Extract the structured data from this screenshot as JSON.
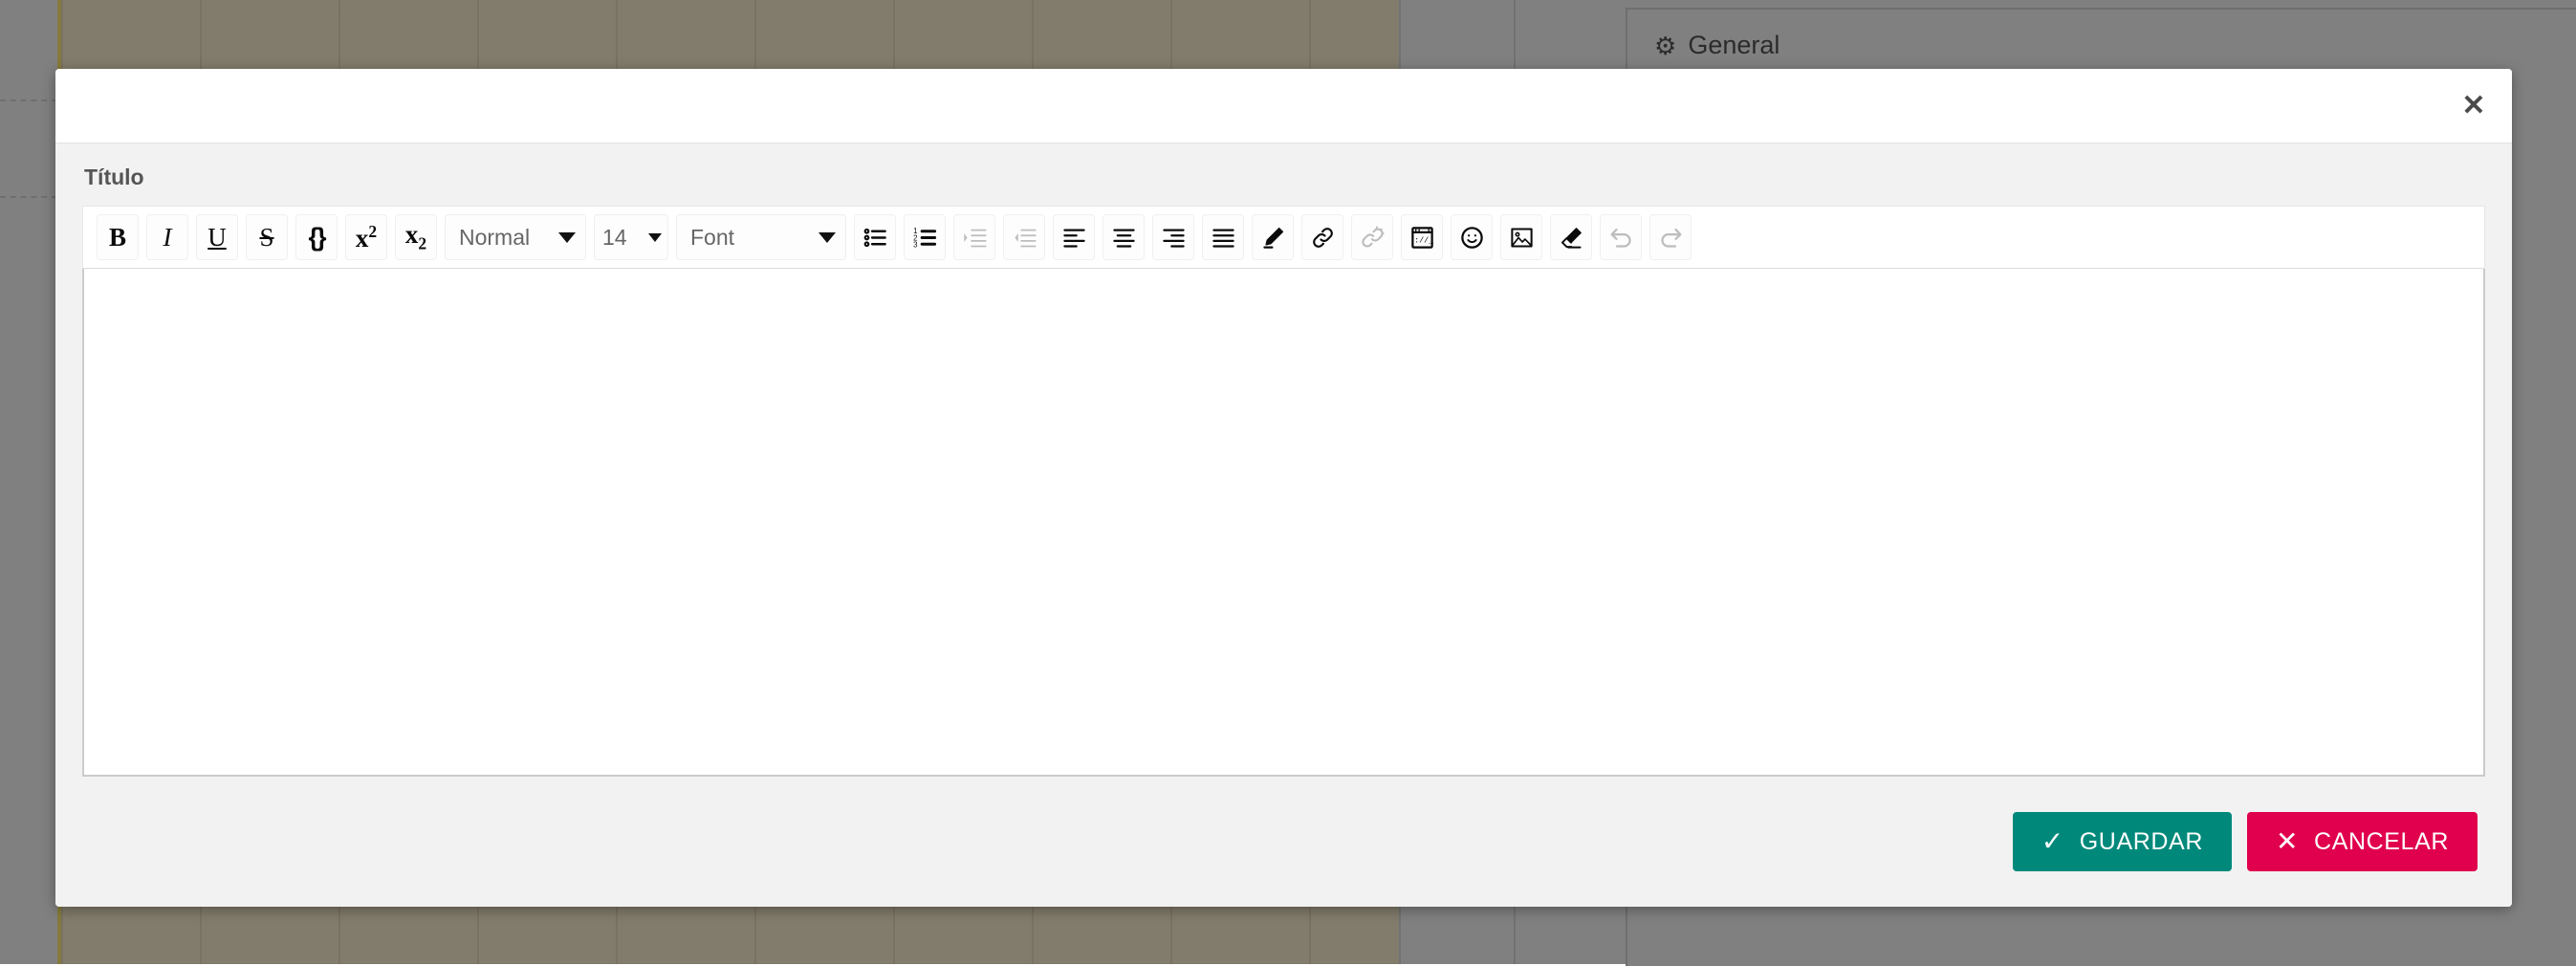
{
  "background": {
    "right_panel": {
      "gear_icon": "gear-icon",
      "title": "General"
    }
  },
  "modal": {
    "close_label": "✕",
    "field_label": "Título",
    "editor": {
      "content": "",
      "placeholder": ""
    },
    "toolbar": {
      "buttons": [
        {
          "name": "bold",
          "glyph": "B",
          "kind": "b",
          "disabled": false,
          "title": "Bold"
        },
        {
          "name": "italic",
          "glyph": "I",
          "kind": "i",
          "disabled": false,
          "title": "Italic"
        },
        {
          "name": "underline",
          "glyph": "U",
          "kind": "u",
          "disabled": false,
          "title": "Underline"
        },
        {
          "name": "strikethrough",
          "glyph": "S",
          "kind": "s",
          "disabled": false,
          "title": "Strikethrough"
        },
        {
          "name": "code-block",
          "glyph": "{}",
          "kind": "code",
          "disabled": false,
          "title": "Code"
        },
        {
          "name": "superscript",
          "glyph": "x",
          "kind": "sup",
          "sup": "2",
          "disabled": false,
          "title": "Superscript"
        },
        {
          "name": "subscript",
          "glyph": "x",
          "kind": "sub",
          "sub": "2",
          "disabled": false,
          "title": "Subscript"
        }
      ],
      "selects": [
        {
          "name": "format-select",
          "value": "Normal",
          "width": "w-format"
        },
        {
          "name": "font-size-select",
          "value": "14",
          "width": "w-size"
        },
        {
          "name": "font-family-select",
          "value": "Font",
          "width": "w-font"
        }
      ],
      "icon_buttons": [
        {
          "name": "bullet-list-icon",
          "icon": "bullet-list",
          "disabled": false
        },
        {
          "name": "numbered-list-icon",
          "icon": "numbered-list",
          "disabled": false
        },
        {
          "name": "indent-increase-icon",
          "icon": "indent-increase",
          "disabled": true
        },
        {
          "name": "indent-decrease-icon",
          "icon": "indent-decrease",
          "disabled": true
        },
        {
          "name": "align-left-icon",
          "icon": "align-left",
          "disabled": false
        },
        {
          "name": "align-center-icon",
          "icon": "align-center",
          "disabled": false
        },
        {
          "name": "align-right-icon",
          "icon": "align-right",
          "disabled": false
        },
        {
          "name": "align-justify-icon",
          "icon": "align-justify",
          "disabled": false
        },
        {
          "name": "highlighter-pen-icon",
          "icon": "pen",
          "disabled": false
        },
        {
          "name": "link-icon",
          "icon": "link",
          "disabled": false
        },
        {
          "name": "unlink-icon",
          "icon": "unlink",
          "disabled": true
        },
        {
          "name": "embed-url-icon",
          "icon": "embed",
          "disabled": false
        },
        {
          "name": "emoji-icon",
          "icon": "emoji",
          "disabled": false
        },
        {
          "name": "image-icon",
          "icon": "image",
          "disabled": false
        },
        {
          "name": "clear-format-eraser-icon",
          "icon": "eraser",
          "disabled": false
        },
        {
          "name": "undo-icon",
          "icon": "undo",
          "disabled": true
        },
        {
          "name": "redo-icon",
          "icon": "redo",
          "disabled": true
        }
      ]
    },
    "footer": {
      "save_label": "GUARDAR",
      "save_icon": "check-icon",
      "cancel_label": "CANCELAR",
      "cancel_icon": "close-x-icon"
    }
  },
  "colors": {
    "save_green": "#00897b",
    "cancel_red": "#e0004d",
    "modal_bg": "#f2f2f2",
    "backdrop_gray": "#808080",
    "canvas_olive": "#827c6c"
  }
}
